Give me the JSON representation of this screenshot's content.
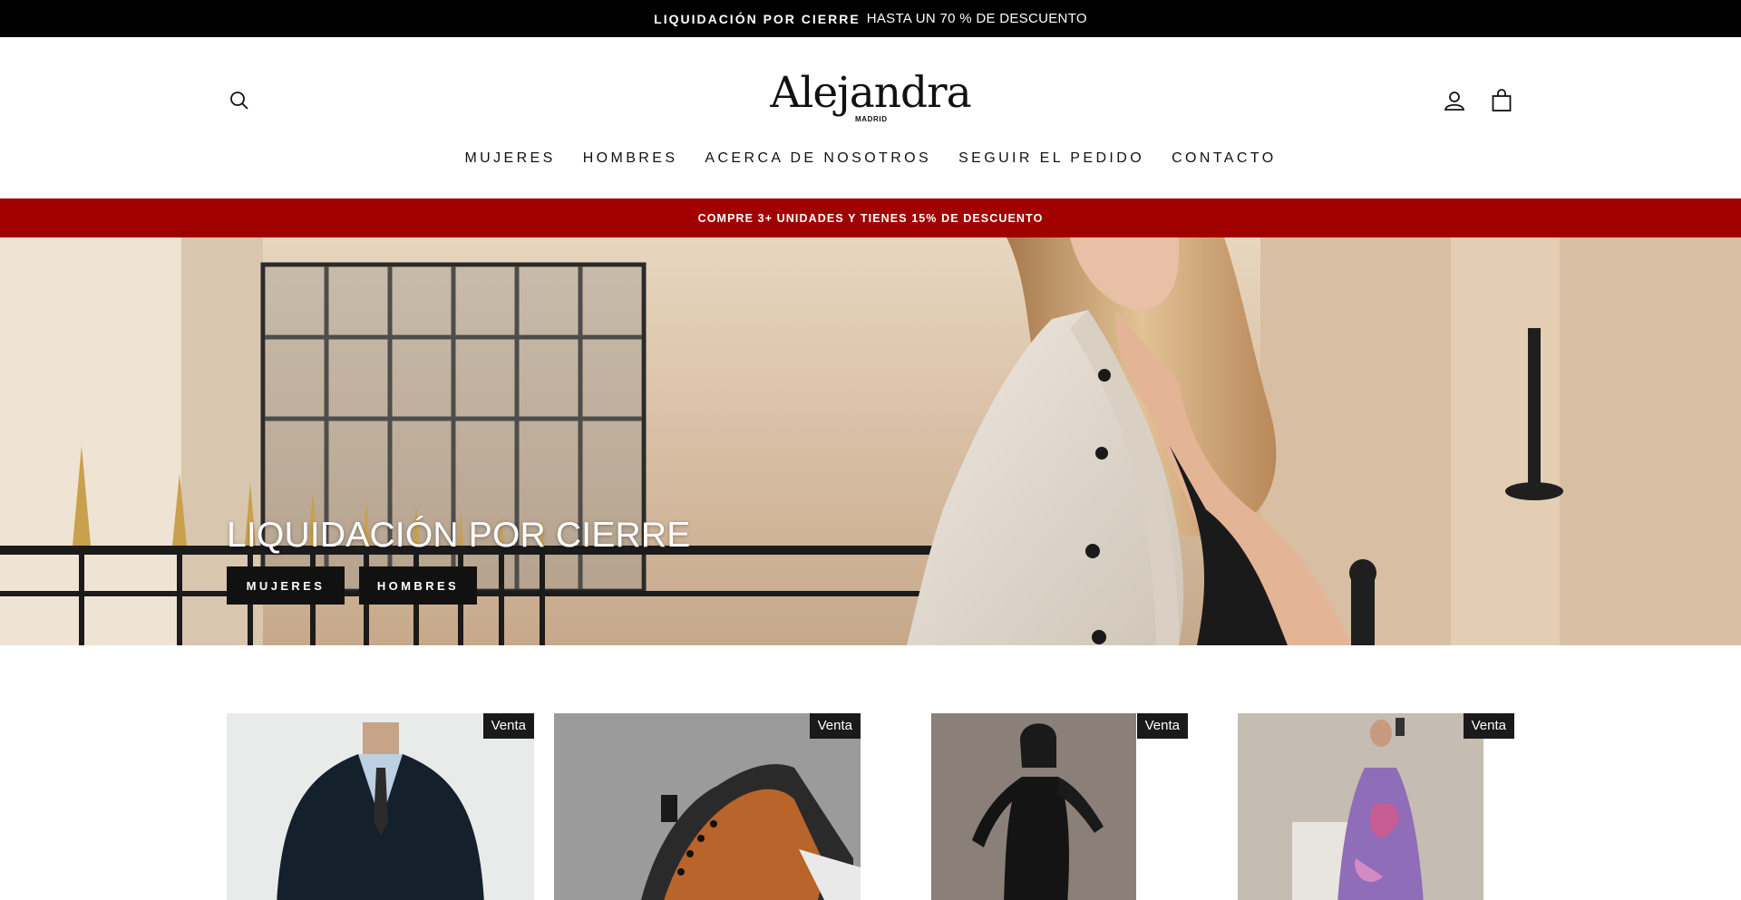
{
  "announcement": {
    "strong": "LIQUIDACIÓN POR CIERRE",
    "light": "HASTA UN 70 % DE DESCUENTO"
  },
  "header": {
    "logo_word": "Alejandra",
    "logo_sub": "MADRID",
    "search_icon": "search-icon",
    "account_icon": "account-icon",
    "cart_icon": "shopping-bag-icon"
  },
  "nav": {
    "items": [
      "MUJERES",
      "HOMBRES",
      "ACERCA DE NOSOTROS",
      "SEGUIR EL PEDIDO",
      "CONTACTO"
    ]
  },
  "promo": {
    "text": "COMPRE 3+ UNIDADES Y TIENES 15% DE DESCUENTO",
    "color": "#a00000"
  },
  "hero": {
    "title": "LIQUIDACIÓN POR CIERRE",
    "buttons": [
      "MUJERES",
      "HOMBRES"
    ]
  },
  "products": [
    {
      "badge": "Venta",
      "image": "navy-velvet-suit"
    },
    {
      "badge": "Venta",
      "image": "orange-black-sneaker"
    },
    {
      "badge": "Venta",
      "image": "black-jumpsuit"
    },
    {
      "badge": "Venta",
      "image": "purple-floral-dress"
    }
  ]
}
